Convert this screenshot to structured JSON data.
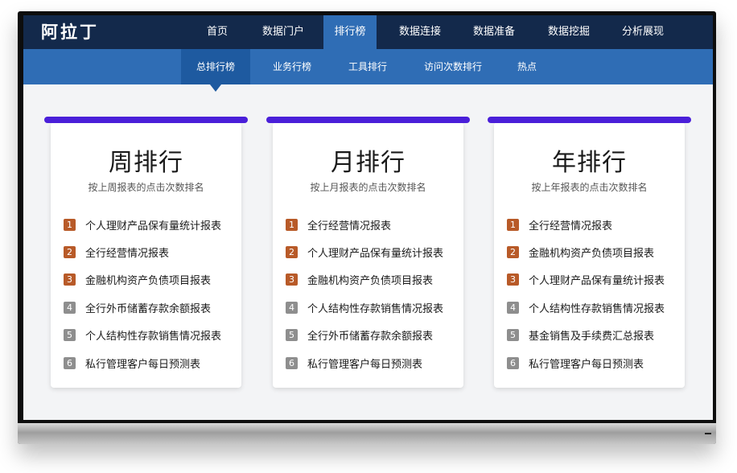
{
  "header": {
    "logo": "阿拉丁",
    "nav": [
      "首页",
      "数据门户",
      "排行榜",
      "数据连接",
      "数据准备",
      "数据挖掘",
      "分析展现"
    ],
    "active_nav": "排行榜"
  },
  "subnav": {
    "items": [
      "总排行榜",
      "业务行榜",
      "工具排行",
      "访问次数排行",
      "热点"
    ],
    "active": "总排行榜"
  },
  "colors": {
    "topnav_bg": "#13294b",
    "subnav_bg": "#2f6db5",
    "card_accent": "#4a1fd9",
    "rank_top": "#b85a28",
    "rank_rest": "#8e8e8e"
  },
  "cards": [
    {
      "title": "周排行",
      "subtitle": "按上周报表的点击次数排名",
      "items": [
        {
          "rank": "1",
          "name": "个人理财产品保有量统计报表"
        },
        {
          "rank": "2",
          "name": "全行经营情况报表"
        },
        {
          "rank": "3",
          "name": "金融机构资产负债项目报表"
        },
        {
          "rank": "4",
          "name": "全行外币储蓄存款余额报表"
        },
        {
          "rank": "5",
          "name": "个人结构性存款销售情况报表"
        },
        {
          "rank": "6",
          "name": "私行管理客户每日预测表"
        }
      ]
    },
    {
      "title": "月排行",
      "subtitle": "按上月报表的点击次数排名",
      "items": [
        {
          "rank": "1",
          "name": "全行经营情况报表"
        },
        {
          "rank": "2",
          "name": "个人理财产品保有量统计报表"
        },
        {
          "rank": "3",
          "name": "金融机构资产负债项目报表"
        },
        {
          "rank": "4",
          "name": "个人结构性存款销售情况报表"
        },
        {
          "rank": "5",
          "name": "全行外币储蓄存款余额报表"
        },
        {
          "rank": "6",
          "name": "私行管理客户每日预测表"
        }
      ]
    },
    {
      "title": "年排行",
      "subtitle": "按上年报表的点击次数排名",
      "items": [
        {
          "rank": "1",
          "name": "全行经营情况报表"
        },
        {
          "rank": "2",
          "name": "金融机构资产负债项目报表"
        },
        {
          "rank": "3",
          "name": "个人理财产品保有量统计报表"
        },
        {
          "rank": "4",
          "name": "个人结构性存款销售情况报表"
        },
        {
          "rank": "5",
          "name": "基金销售及手续费汇总报表"
        },
        {
          "rank": "6",
          "name": "私行管理客户每日预测表"
        }
      ]
    }
  ]
}
